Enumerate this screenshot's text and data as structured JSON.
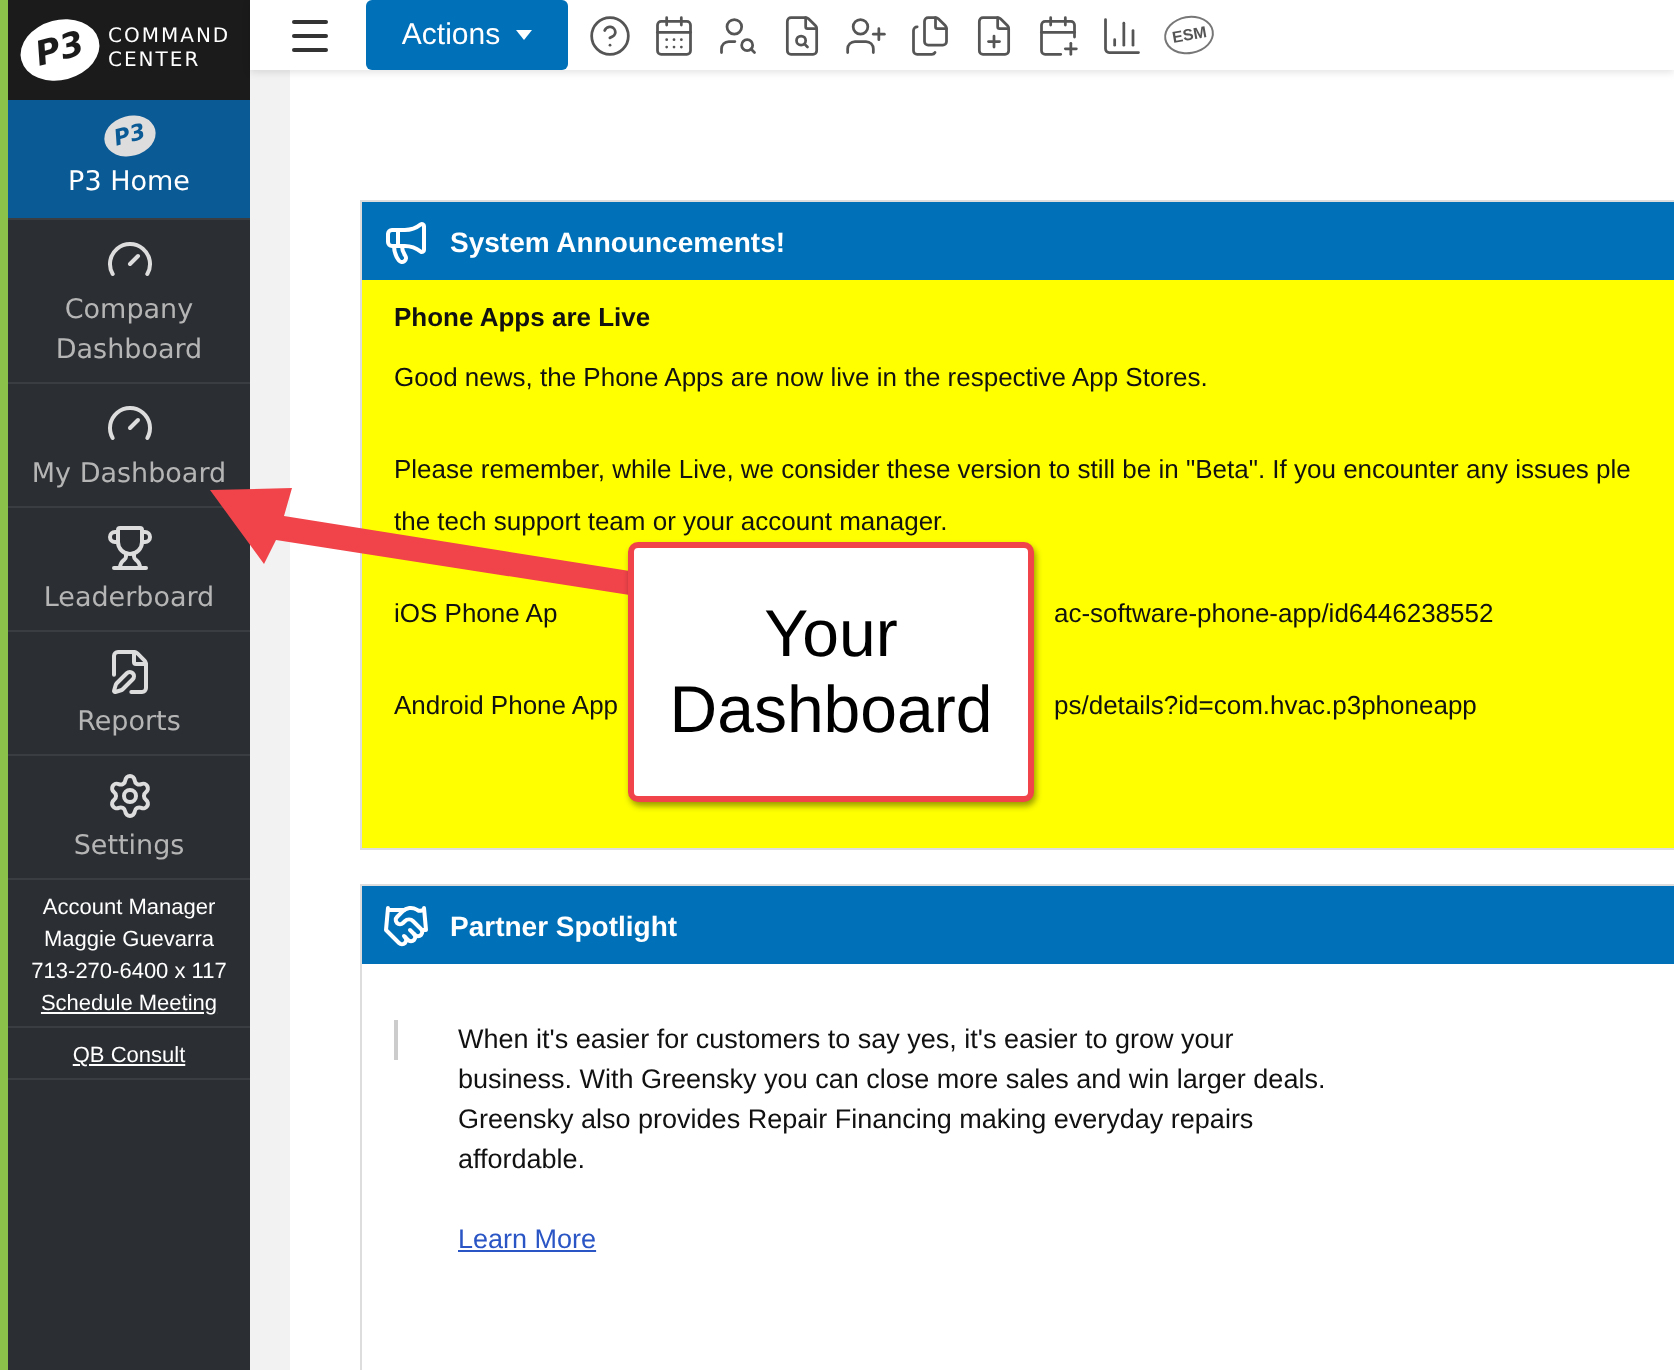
{
  "logo": {
    "mark": "P3",
    "line_1": "COMMAND",
    "line_2": "CENTER"
  },
  "toolbar": {
    "actions_button": "Actions",
    "icons": [
      {
        "kind": "help"
      },
      {
        "kind": "calendar"
      },
      {
        "kind": "user-search"
      },
      {
        "kind": "invoice-search"
      },
      {
        "kind": "user-add"
      },
      {
        "kind": "documents"
      },
      {
        "kind": "invoice-add"
      },
      {
        "kind": "calendar-add"
      },
      {
        "kind": "chart"
      },
      {
        "kind": "badge",
        "label": "ESM"
      }
    ]
  },
  "sidebar": {
    "items": [
      {
        "kind": "logo",
        "mark": "P3",
        "label": "P3 Home",
        "selected": true
      },
      {
        "kind": "gauge",
        "label": "Company Dashboard",
        "selected": false
      },
      {
        "kind": "gauge",
        "label": "My Dashboard",
        "selected": false
      },
      {
        "kind": "trophy",
        "label": "Leaderboard",
        "selected": false
      },
      {
        "kind": "report",
        "label": "Reports",
        "selected": false
      },
      {
        "kind": "gear",
        "label": "Settings",
        "selected": false
      }
    ],
    "account": {
      "title": "Account Manager",
      "name": "Maggie Guevarra",
      "phone": "713-270-6400 x 117",
      "link": "Schedule Meeting"
    },
    "consult_link": "QB Consult"
  },
  "announcements": {
    "title": "System Announcements!",
    "heading": "Phone Apps are Live",
    "lines": [
      {
        "kind": "text",
        "text": "Good news, the Phone Apps are now live in the respective App Stores."
      },
      {
        "kind": "text",
        "text": "Please remember, while Live, we consider these version to still be in \"Beta\". If you encounter any issues ple"
      },
      {
        "kind": "text",
        "text": "the tech support team or your account manager."
      },
      {
        "kind": "split",
        "before": "iOS Phone Ap",
        "after": "ac-software-phone-app/id6446238552"
      },
      {
        "kind": "split",
        "before": "Android Phone App",
        "after": "ps/details?id=com.hvac.p3phoneapp"
      }
    ]
  },
  "spotlight": {
    "title": "Partner Spotlight",
    "quote": "When it's easier for customers to say yes, it's easier to grow your business. With Greensky you can close more sales and win larger deals. Greensky also provides Repair Financing making everyday repairs affordable.",
    "link": "Learn More"
  },
  "callout": {
    "line_1": "Your",
    "line_2": "Dashboard"
  }
}
